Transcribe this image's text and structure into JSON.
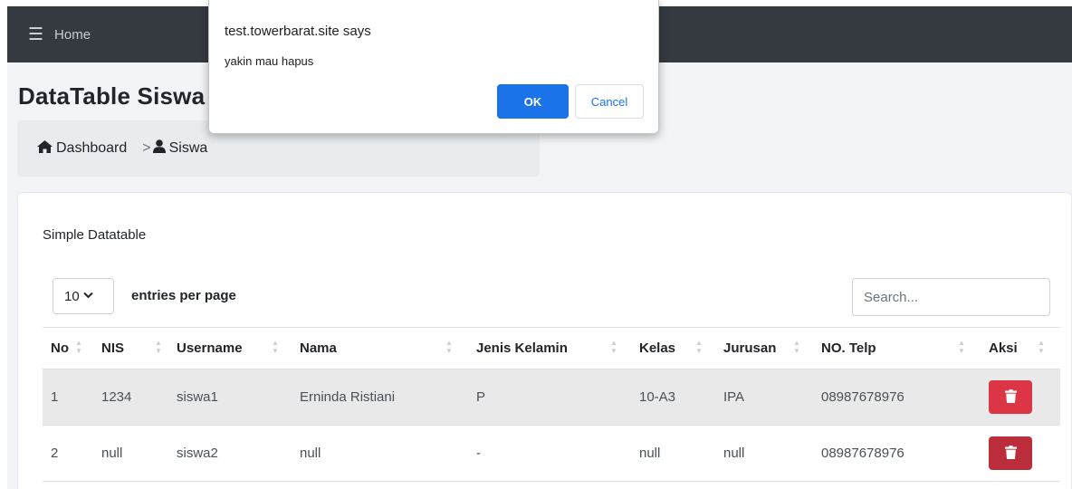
{
  "topbar": {
    "menu_icon": "hamburger-icon",
    "home_label": "Home"
  },
  "page": {
    "title": "DataTable Siswa"
  },
  "breadcrumb": {
    "items": [
      {
        "icon": "home-icon",
        "label": "Dashboard"
      },
      {
        "separator": ">",
        "icon": "user-icon",
        "label": "Siswa"
      }
    ]
  },
  "card": {
    "title": "Simple Datatable",
    "entries": {
      "value": "10",
      "label": "entries per page"
    },
    "search": {
      "placeholder": "Search..."
    }
  },
  "table": {
    "columns": [
      "No",
      "NIS",
      "Username",
      "Nama",
      "Jenis Kelamin",
      "Kelas",
      "Jurusan",
      "NO. Telp",
      "Aksi"
    ],
    "rows": [
      {
        "no": "1",
        "nis": "1234",
        "username": "siswa1",
        "nama": "Erninda Ristiani",
        "jk": "P",
        "kelas": "10-A3",
        "jurusan": "IPA",
        "telp": "08987678976",
        "action_icon": "trash-icon"
      },
      {
        "no": "2",
        "nis": "null",
        "username": "siswa2",
        "nama": "null",
        "jk": "-",
        "kelas": "null",
        "jurusan": "null",
        "telp": "08987678976",
        "action_icon": "trash-icon"
      }
    ]
  },
  "dialog": {
    "title": "test.towerbarat.site says",
    "message": "yakin mau hapus",
    "ok_label": "OK",
    "cancel_label": "Cancel"
  },
  "colors": {
    "topbar": "#343a40",
    "danger": "#dc3545",
    "primary": "#1a73e8"
  }
}
